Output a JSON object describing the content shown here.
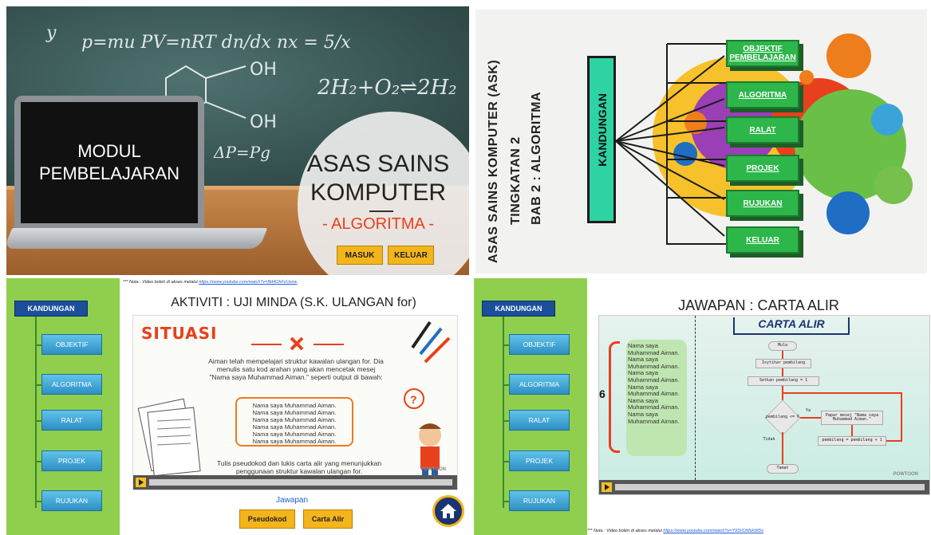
{
  "title_slide": {
    "laptop_line1": "MODUL",
    "laptop_line2": "PEMBELAJARAN",
    "title_line1": "ASAS SAINS",
    "title_line2": "KOMPUTER",
    "subtitle": "- ALGORITMA -",
    "masuk_label": "MASUK",
    "keluar_label": "KELUAR",
    "board_formula": "p=mu  PV=nRT  dn/dx nx = 5/x",
    "board_chem_oh1": "OH",
    "board_chem_oh2": "OH",
    "board_chem_eq": "2H₂+O₂⇌2H₂",
    "board_chem_eq2": "ΔP=Pg"
  },
  "menu_slide": {
    "vertical_title1": "ASAS SAINS KOMPUTER (ASK)",
    "vertical_title2": "TINGKATAN 2",
    "vertical_title3": "BAB 2 : ALGORITMA",
    "kandungan_label": "KANDUNGAN",
    "items": [
      "OBJEKTIF PEMBELAJARAN",
      "ALGORITMA",
      "RALAT",
      "PROJEK",
      "RUJUKAN",
      "KELUAR"
    ]
  },
  "sidebar": {
    "kandungan": "KANDUNGAN",
    "items": [
      "OBJEKTIF",
      "ALGORITMA",
      "RALAT",
      "PROJEK",
      "RUJUKAN"
    ]
  },
  "activity_slide": {
    "nota_prefix": "*** Nota : Video boleh di akses melalui",
    "nota_link": "https://www.youtube.com/watch?v=Bd4OhFzUsnw",
    "title": "AKTIVITI : UJI MINDA (S.K. ULANGAN for)",
    "situasi": "SITUASI",
    "scenario": "Aiman telah mempelajari struktur kawalan ulangan for. Dia menulis satu kod arahan yang akan mencetak mesej \"Nama saya Muhammad Aiman.\" seperti output di bawah:",
    "output_lines": [
      "Nama saya Muhammad Aiman.",
      "Nama saya Muhammad Aiman.",
      "Nama saya Muhammad Aiman.",
      "Nama saya Muhammad Aiman.",
      "Nama saya Muhammad Aiman.",
      "Nama saya Muhammad Aiman."
    ],
    "instruction": "Tulis pseudokod dan lukis carta alir yang menunjukkan penggunaan struktur kawalan ulangan for.",
    "watermark": "POWTOON",
    "jawapan_label": "Jawapan",
    "pseudokod_label": "Pseudokod",
    "carta_alir_label": "Carta Alir"
  },
  "answer_slide": {
    "title": "JAWAPAN : CARTA ALIR",
    "carta_title": "CARTA ALIR",
    "six": "6",
    "names": [
      "Nama saya",
      "Muhammad Aiman.",
      "Nama saya",
      "Muhammad Aiman.",
      "Nama saya",
      "Muhammad Aiman.",
      "Nama saya",
      "Muhammad Aiman.",
      "Nama saya",
      "Muhammad Aiman.",
      "Nama saya",
      "Muhammad Aiman."
    ],
    "fc_mula": "Mula",
    "fc_isytihar": "Isytihar pembilang",
    "fc_setkan": "Setkan pembilang = 1",
    "fc_cond": "pembilang <= 6",
    "fc_ya": "Ya",
    "fc_tidak": "Tidak",
    "fc_papar": "Papar mesej \"Nama saya Muhammad Aiman.\"",
    "fc_inc": "pembilang = pembilang + 1",
    "fc_tamat": "Tamat",
    "watermark": "POWTOON",
    "nota_prefix": "*** Nota : Video boleh di akses melalui",
    "nota_link": "https://www.youtube.com/watch?v=Y93VOMskWDs"
  }
}
